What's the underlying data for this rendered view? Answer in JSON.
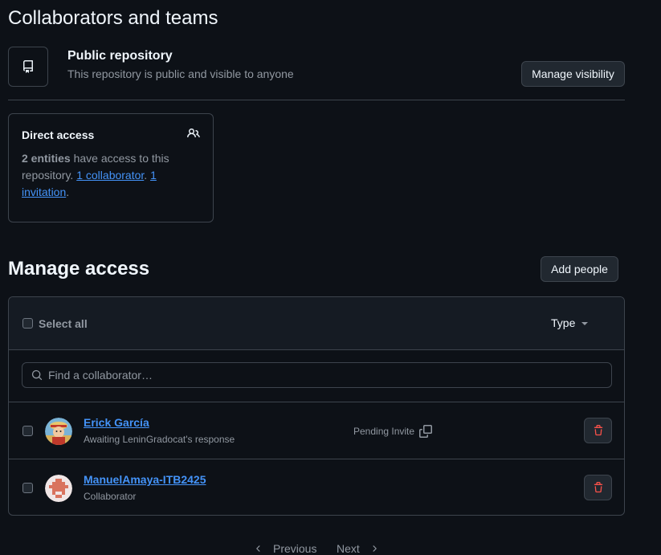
{
  "header": {
    "title": "Collaborators and teams",
    "repo_title": "Public repository",
    "repo_desc": "This repository is public and visible to anyone",
    "manage_visibility_label": "Manage visibility"
  },
  "direct_access": {
    "title": "Direct access",
    "entities": "2 entities",
    "text_mid": " have access to this repository. ",
    "collaborator_link": "1 collaborator",
    "sep": ". ",
    "invitation_link": "1 invitation",
    "end": "."
  },
  "manage_access": {
    "title": "Manage access",
    "add_people_label": "Add people",
    "select_all_label": "Select all",
    "type_filter_label": "Type",
    "search_placeholder": "Find a collaborator…"
  },
  "collaborators": [
    {
      "name": "Erick García",
      "subtitle": "Awaiting LeninGradocat's response",
      "status": "Pending Invite"
    },
    {
      "name": "ManuelAmaya-ITB2425",
      "subtitle": "Collaborator"
    }
  ],
  "pagination": {
    "previous": "Previous",
    "next": "Next"
  },
  "colors": {
    "background": "#0d1117",
    "link": "#4493f8",
    "danger": "#f85149",
    "border": "#3d444d"
  },
  "icons": [
    "repo-icon",
    "people-icon",
    "search-icon",
    "copy-icon",
    "trash-icon",
    "chevron-left-icon",
    "chevron-right-icon",
    "caret-down-icon"
  ]
}
